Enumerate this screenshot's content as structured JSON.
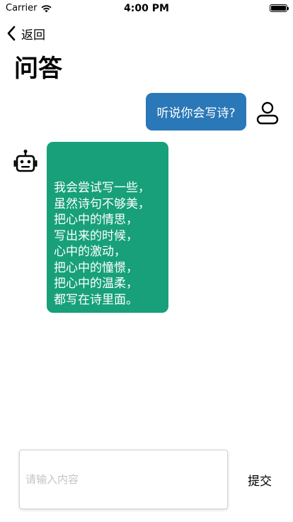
{
  "status_bar": {
    "carrier": "Carrier",
    "time": "4:00 PM",
    "icons": [
      "wifi-icon",
      "battery-icon"
    ]
  },
  "nav": {
    "back_label": "返回",
    "back_icon": "chevron-left-icon"
  },
  "page": {
    "title": "问答"
  },
  "chat": {
    "messages": [
      {
        "sender": "user",
        "avatar_icon": "user-avatar-icon",
        "text": "听说你会写诗?",
        "color": "#2b78b8"
      },
      {
        "sender": "bot",
        "avatar_icon": "robot-avatar-icon",
        "lines": [
          "我会尝试写一些，",
          "虽然诗句不够美，",
          "把心中的情思，",
          "写出来的时候，",
          "心中的激动，",
          "把心中的憧憬，",
          "把心中的温柔，",
          "都写在诗里面。"
        ],
        "color": "#17a07a"
      }
    ]
  },
  "composer": {
    "value": "",
    "placeholder": "请输入内容",
    "submit_label": "提交"
  }
}
